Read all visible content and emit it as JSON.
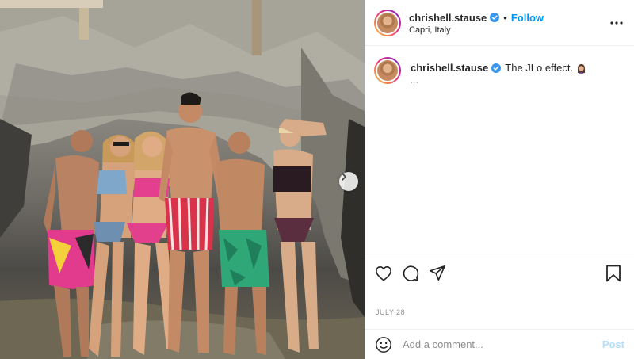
{
  "post": {
    "username": "chrishell.stause",
    "location": "Capri, Italy",
    "follow_label": "Follow",
    "separator": "•",
    "caption": "The JLo effect.",
    "caption_more": "...",
    "date": "JULY 28"
  },
  "comment": {
    "placeholder": "Add a comment...",
    "post_label": "Post"
  },
  "icons": {
    "verified": "verified-badge-icon",
    "more": "more-options-icon",
    "like": "heart-icon",
    "comment": "comment-bubble-icon",
    "share": "paper-plane-icon",
    "save": "bookmark-icon",
    "emoji": "smiley-icon",
    "next": "chevron-right-icon",
    "caption_emoji": "woman-emoji-icon"
  },
  "colors": {
    "accent": "#0095f6",
    "post_disabled": "#b2dffc",
    "muted": "#8e8e8e",
    "border": "#efefef"
  }
}
